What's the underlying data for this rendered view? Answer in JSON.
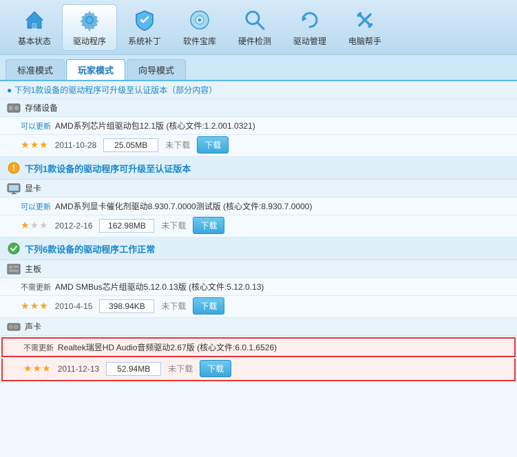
{
  "nav": {
    "items": [
      {
        "id": "home",
        "label": "基本状态",
        "active": false
      },
      {
        "id": "driver",
        "label": "驱动程序",
        "active": true
      },
      {
        "id": "patch",
        "label": "系统补丁",
        "active": false
      },
      {
        "id": "software",
        "label": "软件宝库",
        "active": false
      },
      {
        "id": "hardware",
        "label": "硬件检测",
        "active": false
      },
      {
        "id": "manage",
        "label": "驱动管理",
        "active": false
      },
      {
        "id": "help",
        "label": "电脑帮手",
        "active": false
      }
    ]
  },
  "tabs": [
    {
      "id": "standard",
      "label": "标准模式",
      "active": false
    },
    {
      "id": "gamer",
      "label": "玩家模式",
      "active": true
    },
    {
      "id": "wizard",
      "label": "向导模式",
      "active": false
    }
  ],
  "sections": [
    {
      "id": "storage",
      "type": "category-header",
      "icon": "storage",
      "label": "存储设备",
      "drivers": [
        {
          "status": "可以更新",
          "name": "AMD系列芯片组驱动包12.1版 (核心文件:1.2.001.0321)",
          "stars": [
            true,
            true,
            true
          ],
          "date": "2011-10-28",
          "size": "25.05MB",
          "downloaded": "未下载",
          "canDownload": true
        }
      ]
    },
    {
      "id": "upgrade-section",
      "type": "info-header",
      "icon": "info",
      "label": "下列1款设备的驱动程序可升级至认证版本"
    },
    {
      "id": "display",
      "type": "category-header",
      "icon": "display",
      "label": "显卡",
      "drivers": [
        {
          "status": "可以更新",
          "name": "AMD系列显卡催化剂驱动8.930.7.0000测试版 (核心文件:8.930.7.0000)",
          "stars": [
            true,
            false,
            false
          ],
          "date": "2012-2-16",
          "size": "162.98MB",
          "downloaded": "未下载",
          "canDownload": true
        }
      ]
    },
    {
      "id": "working-section",
      "type": "success-header",
      "icon": "check",
      "label": "下列6款设备的驱动程序工作正常"
    },
    {
      "id": "motherboard",
      "type": "category-header",
      "icon": "motherboard",
      "label": "主板",
      "drivers": [
        {
          "status": "不需更新",
          "name": "AMD SMBus芯片组驱动5.12.0.13版 (核心文件:5.12.0.13)",
          "stars": [
            true,
            true,
            true
          ],
          "date": "2010-4-15",
          "size": "398.94KB",
          "downloaded": "未下载",
          "canDownload": true
        }
      ]
    },
    {
      "id": "audio",
      "type": "category-header",
      "icon": "audio",
      "label": "声卡",
      "drivers": [
        {
          "status": "不需更新",
          "name": "Realtek瑞昱HD Audio音频驱动2.67版 (核心文件:6.0.1.6526)",
          "stars": [
            true,
            true,
            true
          ],
          "date": "2011-12-13",
          "size": "52.94MB",
          "downloaded": "未下载",
          "canDownload": true,
          "highlighted": true
        }
      ]
    }
  ],
  "partial_top": "下列1款设备的驱动程序可升级至认证版本",
  "bottom_partial": "下列6款设备的驱动程序工作正常 (核心文件:6.0.1.6526)"
}
